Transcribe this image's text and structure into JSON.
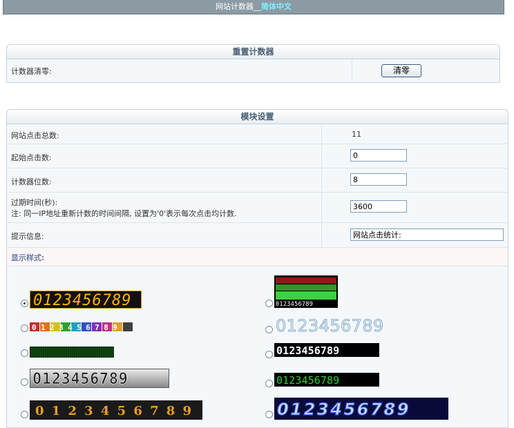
{
  "header": {
    "title": "网站计数器",
    "separator": "__",
    "lang": "简体中文"
  },
  "reset_panel": {
    "title": "重置计数器",
    "label": "计数器清零:",
    "button": "清零"
  },
  "module_panel": {
    "title": "模块设置",
    "rows": [
      {
        "label": "网站点击总数:",
        "value": "11"
      },
      {
        "label": "起始点击数:",
        "value": "0"
      },
      {
        "label": "计数器位数:",
        "value": "8"
      },
      {
        "label": "过期时间(秒):",
        "note": "注: 同一IP地址重新计数的时间间隔, 设置为'0'表示每次点击均计数.",
        "value": "3600"
      },
      {
        "label": "提示信息:",
        "value": "网站点击统计:"
      }
    ],
    "styles_label": "显示样式:"
  },
  "styles": {
    "digits": "0123456789",
    "selected_index": 0,
    "colors": {
      "accent": "#6b7fa8",
      "panel_bg": "#f5f8fa",
      "header_bg": "#8c9aa4"
    }
  }
}
